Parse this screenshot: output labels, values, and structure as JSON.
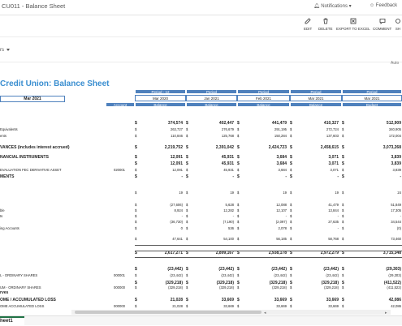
{
  "window": {
    "title": "CU011 - Balance Sheet",
    "notifications": "Notifications",
    "feedback": "Feedback"
  },
  "toolbar": {
    "edit": "EDIT",
    "delete": "DELETE",
    "export": "EXPORT TO EXCEL",
    "comment": "COMMENT",
    "share": "SH"
  },
  "filters": {
    "selector_fragment": "rs",
    "auto_fragment": "Auto"
  },
  "report": {
    "title": "Credit Union: Balance Sheet",
    "month": "Mar 2021"
  },
  "columns": {
    "period_row": [
      "Period - 12",
      "Period",
      "Period",
      "Period",
      "Period",
      "Period"
    ],
    "month_row": [
      "Mar 2020",
      "Jan 2021",
      "Feb 2021",
      "Mar 2021",
      "Mar 2021"
    ],
    "sub_row": [
      "Account",
      "Balance",
      "Balance",
      "Balance",
      "Balance",
      "Balance",
      "Budget"
    ]
  },
  "rows": [
    {
      "label": "",
      "acct": "",
      "vals": [
        "374,574",
        "402,447",
        "441,479",
        "410,327",
        "512,909"
      ],
      "dollar": true,
      "bold": true
    },
    {
      "label": "Equivalents",
      "acct": "",
      "vals": [
        "263,727",
        "276,679",
        "291,195",
        "272,724",
        "340,905"
      ],
      "dollar": true
    },
    {
      "label": "ents",
      "acct": "",
      "vals": [
        "110,846",
        "125,768",
        "150,284",
        "137,603",
        "172,004"
      ],
      "dollar": true
    },
    {
      "label": "VANCES (includes interest accrued)",
      "acct": "",
      "vals": [
        "2,219,752",
        "2,391,042",
        "2,424,723",
        "2,458,615",
        "3,073,268"
      ],
      "dollar": true,
      "bold": true
    },
    {
      "label": "NANCIAL INSTRUMENTS",
      "acct": "",
      "vals": [
        "12,091",
        "45,931",
        "3,684",
        "3,071",
        "3,839"
      ],
      "dollar": true,
      "bold": true
    },
    {
      "label": "",
      "acct": "",
      "vals": [
        "12,091",
        "45,931",
        "3,684",
        "3,071",
        "3,839"
      ],
      "dollar": true,
      "bold": true
    },
    {
      "label": "EVALUATION FEC DERIVATIVE ASSET",
      "acct": "020001",
      "vals": [
        "12,091",
        "45,931",
        "3,684",
        "3,071",
        "3,839"
      ],
      "dollar": true
    },
    {
      "label": "MENTS",
      "acct": "",
      "vals": [
        "-",
        "-",
        "-",
        "-",
        "-"
      ],
      "dollar": true,
      "bold": true
    },
    {
      "label": "",
      "acct": "",
      "vals": [
        "19",
        "19",
        "19",
        "19",
        "24"
      ],
      "dollar": true
    },
    {
      "label": "",
      "acct": "",
      "vals": [
        "(27,606)",
        "5,628",
        "12,088",
        "41,479",
        "51,849"
      ],
      "dollar": true
    },
    {
      "label": "ble",
      "acct": "",
      "vals": [
        "8,924",
        "12,282",
        "12,107",
        "13,844",
        "17,305"
      ],
      "dollar": true
    },
    {
      "label": "ts",
      "acct": "",
      "vals": [
        "-",
        "-",
        "-",
        "-",
        "-"
      ],
      "dollar": true
    },
    {
      "label": "",
      "acct": "",
      "vals": [
        "(36,730)",
        "(7,190)",
        "(2,097)",
        "27,635",
        "34,544"
      ],
      "dollar": true
    },
    {
      "label": "ing Accounts",
      "acct": "",
      "vals": [
        "0",
        "536",
        "2,078",
        "-",
        "(0)"
      ],
      "dollar": true
    },
    {
      "label": "",
      "acct": "",
      "vals": [
        "47,641",
        "54,100",
        "56,185",
        "58,768",
        "73,460"
      ],
      "dollar": true
    },
    {
      "label": "",
      "acct": "",
      "vals": [
        "2,617,271",
        "2,899,167",
        "2,938,178",
        "2,972,279",
        "3,715,348"
      ],
      "dollar": true,
      "bold": true
    },
    {
      "label": "",
      "acct": "",
      "vals": [
        "(23,442)",
        "(23,442)",
        "(23,442)",
        "(23,442)",
        "(29,303)"
      ],
      "dollar": true,
      "bold": true
    },
    {
      "label": "L - ORDINARY SHARES",
      "acct": "000001",
      "vals": [
        "(23,442)",
        "(23,442)",
        "(23,442)",
        "(23,442)",
        "(29,303)"
      ],
      "dollar": true
    },
    {
      "label": "",
      "acct": "",
      "vals": [
        "(329,218)",
        "(329,218)",
        "(329,218)",
        "(329,218)",
        "(411,522)"
      ],
      "dollar": true,
      "bold": true
    },
    {
      "label": "UM - ORDINARY SHARES",
      "acct": "000000",
      "vals": [
        "(329,218)",
        "(329,218)",
        "(329,218)",
        "(329,218)",
        "(411,522)"
      ],
      "dollar": true
    },
    {
      "label": "rves",
      "acct": "",
      "vals": [
        "",
        "",
        "",
        "",
        ""
      ],
      "dollar": false,
      "bold": true
    },
    {
      "label": "OME / ACCUMULATED LOSS",
      "acct": "",
      "vals": [
        "21,028",
        "33,669",
        "33,669",
        "33,669",
        "42,086"
      ],
      "dollar": true,
      "bold": true
    },
    {
      "label": "OME ACCUMULATED LOSS",
      "acct": "000000",
      "vals": [
        "21,028",
        "33,669",
        "33,669",
        "33,669",
        "42,086"
      ],
      "dollar": true
    }
  ],
  "sheet_tab": "heet1"
}
